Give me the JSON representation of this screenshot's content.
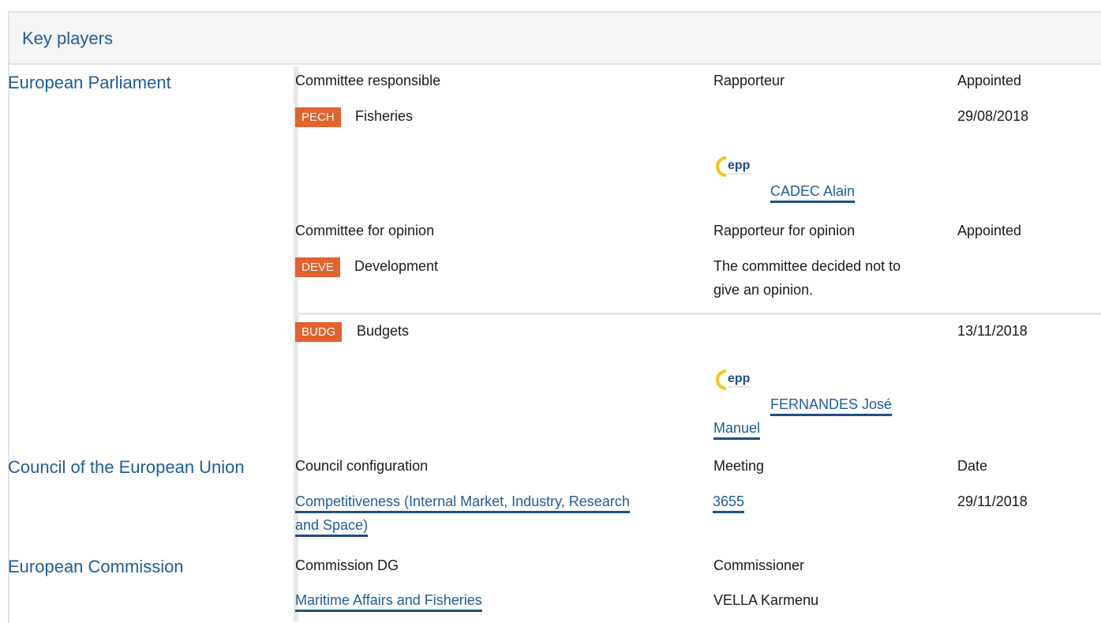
{
  "header": {
    "title": "Key players"
  },
  "parliament": {
    "name": "European Parliament",
    "committee_responsible": {
      "col_committee": "Committee responsible",
      "col_rapporteur": "Rapporteur",
      "col_appointed": "Appointed",
      "code": "PECH",
      "name": "Fisheries",
      "date": "29/08/2018",
      "rapporteur": "CADEC Alain",
      "group_logo": "epp"
    },
    "committee_opinion": {
      "col_committee": "Committee for opinion",
      "col_rapporteur": "Rapporteur for opinion",
      "col_appointed": "Appointed",
      "rows": [
        {
          "code": "DEVE",
          "name": "Development",
          "note_line1": "The committee decided not to",
          "note_line2": "give an opinion."
        },
        {
          "code": "BUDG",
          "name": "Budgets",
          "date": "13/11/2018",
          "rapporteur_line1": "FERNANDES José",
          "rapporteur_line2": "Manuel",
          "group_logo": "epp"
        }
      ]
    },
    "badge_color": "#e2632c"
  },
  "council": {
    "name": "Council of the European Union",
    "col_configuration": "Council configuration",
    "col_meeting": "Meeting",
    "col_date": "Date",
    "configuration_line1": "Competitiveness (Internal Market, Industry, Research",
    "configuration_line2": "and Space)",
    "meeting": "3655",
    "date": "29/11/2018"
  },
  "commission": {
    "name": "European Commission",
    "col_dg": "Commission DG",
    "col_commissioner": "Commissioner",
    "dg": "Maritime Affairs and Fisheries",
    "commissioner": "VELLA Karmenu"
  },
  "colors": {
    "link": "#1f5c99",
    "underline": "#1f4e85",
    "header_bg": "#f6f6f6"
  }
}
